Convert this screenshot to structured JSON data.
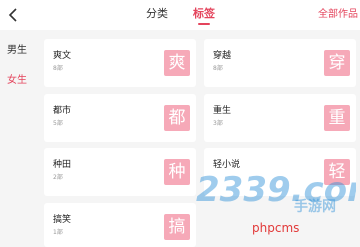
{
  "header": {
    "tabs": [
      "分类",
      "标签"
    ],
    "active_tab": "标签",
    "all_works": "全部作品"
  },
  "sidebar": {
    "items": [
      "男生",
      "女生"
    ],
    "active": "女生"
  },
  "cards": [
    {
      "title": "爽文",
      "count": "8部",
      "badge": "爽"
    },
    {
      "title": "穿越",
      "count": "8部",
      "badge": "穿"
    },
    {
      "title": "都市",
      "count": "5部",
      "badge": "都"
    },
    {
      "title": "重生",
      "count": "3部",
      "badge": "重"
    },
    {
      "title": "种田",
      "count": "2部",
      "badge": "种"
    },
    {
      "title": "轻小说",
      "count": "",
      "badge": "轻"
    },
    {
      "title": "搞笑",
      "count": "1部",
      "badge": "搞"
    }
  ],
  "watermark": {
    "logo": "2339.com",
    "subtitle": "手游网",
    "text": "phpcms"
  },
  "colors": {
    "accent": "#e4445c",
    "badge": "#f6a9b8",
    "background": "#f5f5f5",
    "card": "#ffffff"
  }
}
